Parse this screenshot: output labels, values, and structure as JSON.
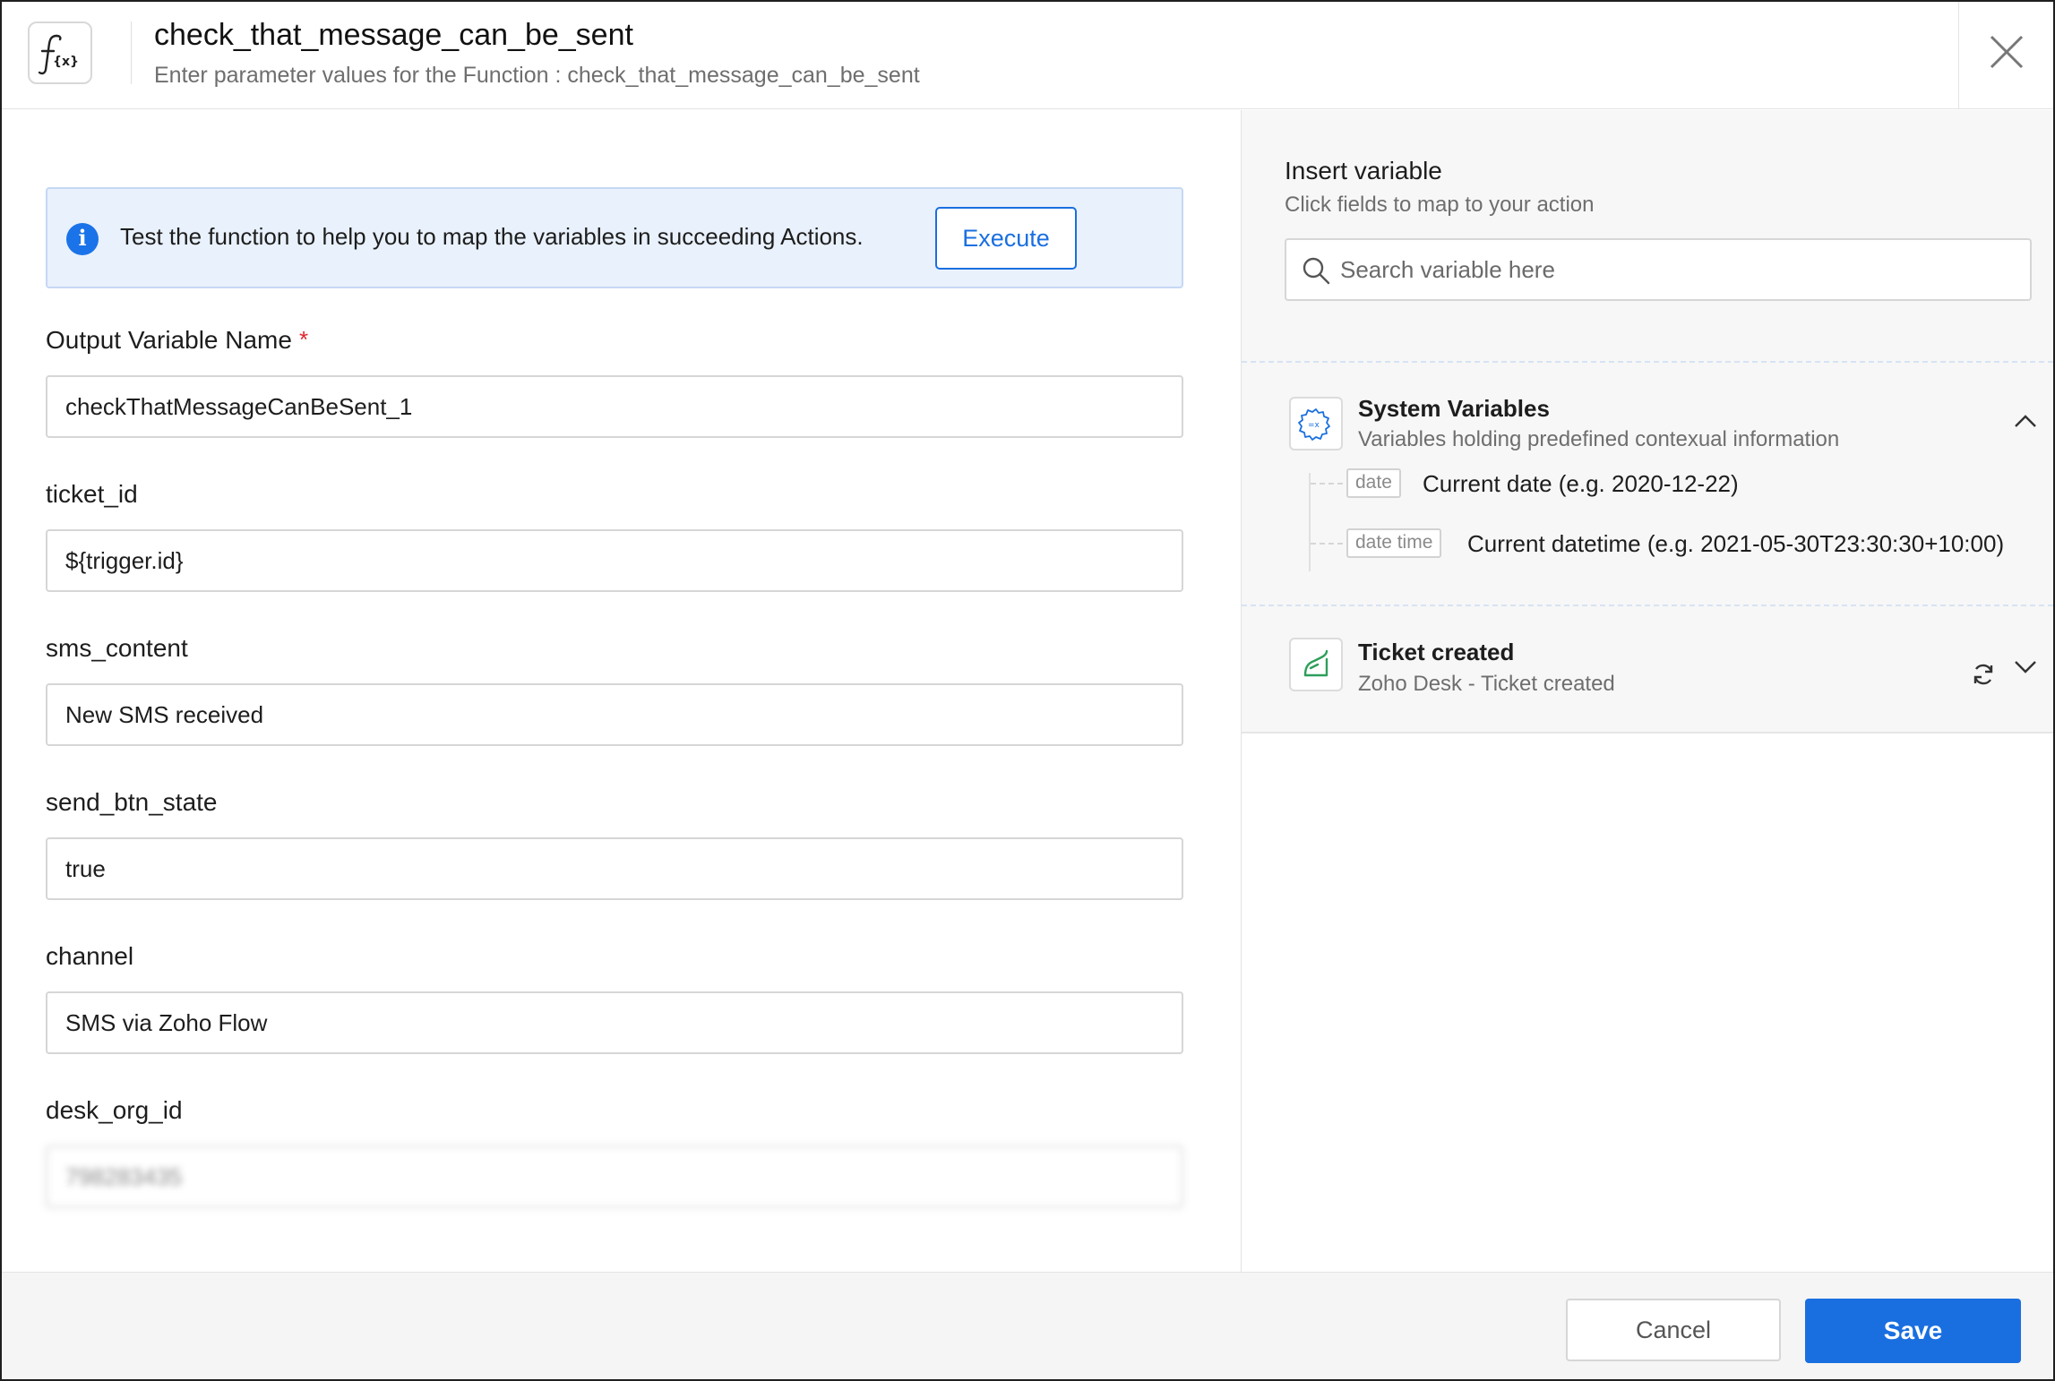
{
  "header": {
    "title": "check_that_message_can_be_sent",
    "subtitle": "Enter parameter values for the Function : check_that_message_can_be_sent",
    "icon": "function-icon",
    "close_icon": "close-icon"
  },
  "info": {
    "icon": "info-icon",
    "icon_glyph": "i",
    "text": "Test the function to help you to map the variables in succeeding Actions.",
    "execute_label": "Execute"
  },
  "form": {
    "fields": [
      {
        "label": "Output Variable Name",
        "required_mark": "*",
        "value": "checkThatMessageCanBeSent_1"
      },
      {
        "label": "ticket_id",
        "value": "${trigger.id}"
      },
      {
        "label": "sms_content",
        "value": "New SMS received"
      },
      {
        "label": "send_btn_state",
        "value": "true"
      },
      {
        "label": "channel",
        "value": "SMS via Zoho Flow"
      },
      {
        "label": "desk_org_id",
        "value": "798283435",
        "blurred": true
      }
    ]
  },
  "insert_variable": {
    "title": "Insert variable",
    "subtitle": "Click fields to map to your action",
    "search_placeholder": "Search variable here",
    "search_icon": "search-icon",
    "system_variables": {
      "icon": "gear-variable-icon",
      "title": "System Variables",
      "subtitle": "Variables holding predefined contexual information",
      "expanded": true,
      "toggle_icon": "chevron-up-icon",
      "items": [
        {
          "tag": "date",
          "label": "Current date (e.g. 2020-12-22)"
        },
        {
          "tag": "date time",
          "label": "Current datetime (e.g. 2021-05-30T23:30:30+10:00)"
        }
      ]
    },
    "ticket_created": {
      "icon": "zoho-desk-icon",
      "title": "Ticket created",
      "subtitle": "Zoho Desk - Ticket created",
      "refresh_icon": "refresh-icon",
      "toggle_icon": "chevron-down-icon",
      "expanded": false
    }
  },
  "footer": {
    "cancel_label": "Cancel",
    "save_label": "Save"
  },
  "colors": {
    "accent": "#1a6fe0",
    "info_bg": "#e9f1fc",
    "required": "#e0262e",
    "desk_green": "#2e9e5b"
  }
}
